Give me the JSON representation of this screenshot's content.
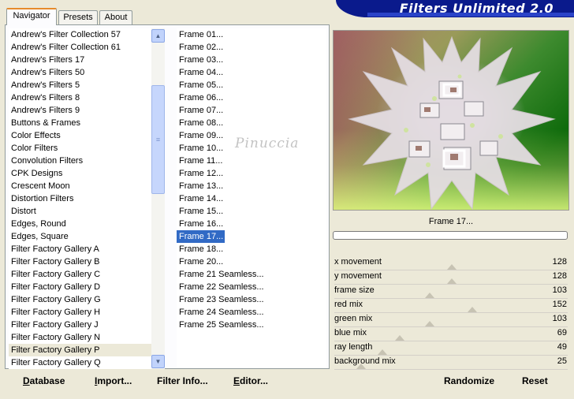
{
  "title": "Filters Unlimited 2.0",
  "tabs": [
    {
      "label": "Navigator",
      "active": true
    },
    {
      "label": "Presets",
      "active": false
    },
    {
      "label": "About",
      "active": false
    }
  ],
  "categories": [
    "Andrew's Filter Collection 57",
    "Andrew's Filter Collection 61",
    "Andrew's Filters 17",
    "Andrew's Filters 50",
    "Andrew's Filters 5",
    "Andrew's Filters 8",
    "Andrew's Filters 9",
    "Buttons & Frames",
    "Color Effects",
    "Color Filters",
    "Convolution Filters",
    "CPK Designs",
    "Crescent Moon",
    "Distortion Filters",
    "Distort",
    "Edges, Round",
    "Edges, Square",
    "Filter Factory Gallery A",
    "Filter Factory Gallery B",
    "Filter Factory Gallery C",
    "Filter Factory Gallery D",
    "Filter Factory Gallery G",
    "Filter Factory Gallery H",
    "Filter Factory Gallery J",
    "Filter Factory Gallery N",
    "Filter Factory Gallery P",
    "Filter Factory Gallery Q"
  ],
  "selected_category": "Filter Factory Gallery P",
  "filters": [
    "Frame 01...",
    "Frame 02...",
    "Frame 03...",
    "Frame 04...",
    "Frame 05...",
    "Frame 06...",
    "Frame 07...",
    "Frame 08...",
    "Frame 09...",
    "Frame 10...",
    "Frame 11...",
    "Frame 12...",
    "Frame 13...",
    "Frame 14...",
    "Frame 15...",
    "Frame 16...",
    "Frame 17...",
    "Frame 18...",
    "Frame 20...",
    "Frame 21 Seamless...",
    "Frame 22 Seamless...",
    "Frame 23 Seamless...",
    "Frame 24 Seamless...",
    "Frame 25 Seamless..."
  ],
  "selected_filter": "Frame 17...",
  "preview": {
    "frame_name": "Frame 17...",
    "watermark": "Pinuccia"
  },
  "sliders": [
    {
      "label": "x movement",
      "value": 128,
      "max": 255
    },
    {
      "label": "y movement",
      "value": 128,
      "max": 255
    },
    {
      "label": "frame size",
      "value": 103,
      "max": 255
    },
    {
      "label": "red mix",
      "value": 152,
      "max": 255
    },
    {
      "label": "green mix",
      "value": 103,
      "max": 255
    },
    {
      "label": "blue mix",
      "value": 69,
      "max": 255
    },
    {
      "label": "ray length",
      "value": 49,
      "max": 255
    },
    {
      "label": "background mix",
      "value": 25,
      "max": 255
    }
  ],
  "buttons": {
    "database": {
      "first": "D",
      "rest": "atabase"
    },
    "import": {
      "first": "I",
      "rest": "mport..."
    },
    "filter_info": {
      "first": "Filter I",
      "rest": "nfo..."
    },
    "editor": {
      "first": "E",
      "rest": "ditor..."
    },
    "randomize": "Randomize",
    "reset": "Reset"
  },
  "colors": {
    "selection": "#316ac5",
    "banner": "#0a1a8c",
    "tab_accent": "#e68b2c"
  }
}
